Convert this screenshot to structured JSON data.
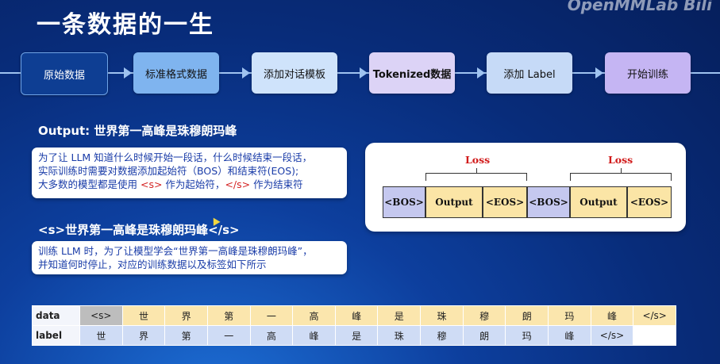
{
  "title": "一条数据的一生",
  "brand": "OpenMMLab Bili",
  "flow": [
    {
      "label": "原始数据",
      "bg": "#0e3e93",
      "fg": "#ffffff"
    },
    {
      "label": "标准格式数据",
      "bg": "#7fb4ef",
      "fg": "#111111"
    },
    {
      "label": "添加对话模板",
      "bg": "#cfe3fb",
      "fg": "#111111"
    },
    {
      "label": "Tokenized数据",
      "bg": "#dcd3f6",
      "fg": "#111111"
    },
    {
      "label": "添加 Label",
      "bg": "#c6daf7",
      "fg": "#111111"
    },
    {
      "label": "开始训练",
      "bg": "#c5b5f3",
      "fg": "#111111"
    }
  ],
  "output_heading": "Output: 世界第一高峰是珠穆朗玛峰",
  "note1": {
    "line1": "为了让 LLM 知道什么时候开始一段话，什么时候结束一段话，",
    "line2": "实际训练时需要对数据添加起始符（BOS）和结束符(EOS);",
    "line3_a": "大多数的模型都是使用 ",
    "line3_tag1": "<s>",
    "line3_b": " 作为起始符，",
    "line3_tag2": "</s>",
    "line3_c": " 作为结束符"
  },
  "seq_heading": "<s>世界第一高峰是珠穆朗玛峰</s>",
  "note2": {
    "line1": "训练 LLM 时，为了让模型学会“世界第一高峰是珠穆朗玛峰”，",
    "line2": "并知道何时停止，对应的训练数据以及标签如下所示"
  },
  "diagram": {
    "loss1": "Loss",
    "loss2": "Loss",
    "bos1": "<BOS>",
    "output1": "Output",
    "eos1": "<EOS>",
    "bos2": "<BOS>",
    "output2": "Output",
    "eos2": "<EOS>",
    "bos_color": "#c5c8ef",
    "output_color": "#fbe5a6"
  },
  "table": {
    "data_header": "data",
    "label_header": "label",
    "data": [
      "<s>",
      "世",
      "界",
      "第",
      "一",
      "高",
      "峰",
      "是",
      "珠",
      "穆",
      "朗",
      "玛",
      "峰",
      "</s>"
    ],
    "label": [
      "世",
      "界",
      "第",
      "一",
      "高",
      "峰",
      "是",
      "珠",
      "穆",
      "朗",
      "玛",
      "峰",
      "</s>",
      ""
    ]
  }
}
